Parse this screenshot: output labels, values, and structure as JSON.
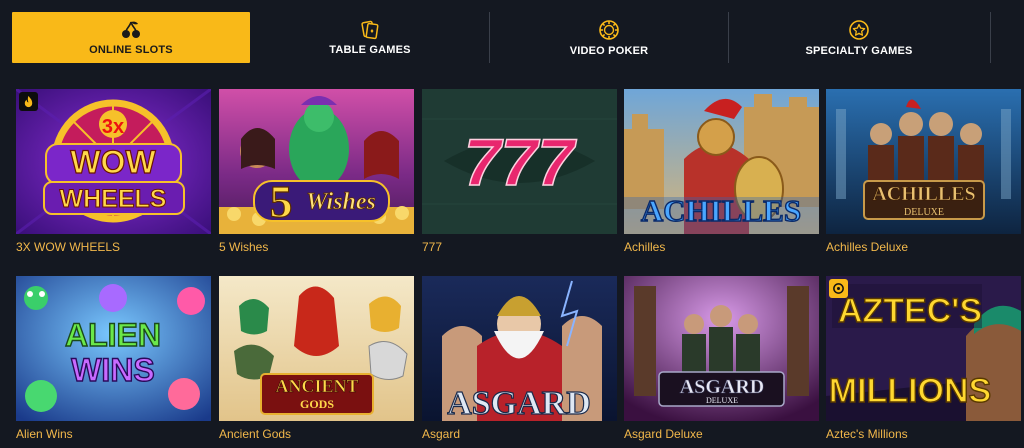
{
  "tabs": [
    {
      "label": "ONLINE SLOTS",
      "icon": "cherries-icon",
      "active": true
    },
    {
      "label": "TABLE GAMES",
      "icon": "playing-cards-icon",
      "active": false
    },
    {
      "label": "VIDEO POKER",
      "icon": "poker-chip-icon",
      "active": false
    },
    {
      "label": "SPECIALTY GAMES",
      "icon": "star-badge-icon",
      "active": false
    }
  ],
  "games": [
    {
      "title": "3X WOW WHEELS",
      "art": [
        "3x",
        "WOW",
        "WHEELS"
      ],
      "badge": "flame-icon"
    },
    {
      "title": "5 Wishes",
      "art": [
        "5",
        "Wishes"
      ]
    },
    {
      "title": "777",
      "art": [
        "777"
      ]
    },
    {
      "title": "Achilles",
      "art": [
        "ACHILLES"
      ]
    },
    {
      "title": "Achilles Deluxe",
      "art": [
        "ACHILLES",
        "DELUXE"
      ]
    },
    {
      "title": "Alien Wins",
      "art": [
        "ALIEN",
        "WINS"
      ]
    },
    {
      "title": "Ancient Gods",
      "art": [
        "ANCIENT",
        "GODS"
      ]
    },
    {
      "title": "Asgard",
      "art": [
        "ASGARD"
      ]
    },
    {
      "title": "Asgard Deluxe",
      "art": [
        "ASGARD",
        "DELUXE"
      ]
    },
    {
      "title": "Aztec's Millions",
      "art": [
        "AZTEC'S",
        "MILLIONS"
      ],
      "badge": "jackpot-icon"
    }
  ],
  "colors": {
    "accent": "#f9b918",
    "background": "#141821",
    "title_text": "#f2b84b"
  }
}
